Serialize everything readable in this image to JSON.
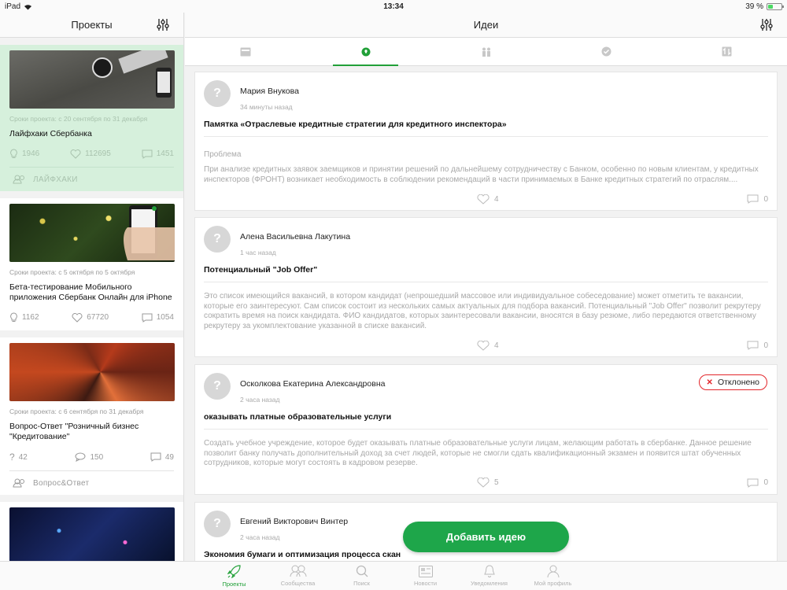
{
  "status": {
    "device": "iPad",
    "time": "13:34",
    "battery": "39 %",
    "battery_level": 0.39
  },
  "left": {
    "title": "Проекты",
    "projects": [
      {
        "dates": "Сроки проекта: с 20 сентября по 31 декабря",
        "title": "Лайфхаки Сбербанка",
        "ideas": "1946",
        "likes": "112695",
        "comments": "1451",
        "tag": "ЛАЙФХАКИ"
      },
      {
        "dates": "Сроки проекта: с 5 октября по 5 октября",
        "title": "Бета-тестирование Мобильного приложения Сбербанк Онлайн для iPhone",
        "ideas": "1162",
        "likes": "67720",
        "comments": "1054"
      },
      {
        "dates": "Сроки проекта: с 6 сентября по 31 декабря",
        "title": "Вопрос-Ответ \"Розничный бизнес \"Кредитование\"",
        "ideas": "42",
        "likes": "150",
        "comments": "49",
        "tag": "Вопрос&Ответ"
      }
    ]
  },
  "main": {
    "title": "Идеи",
    "ideas": [
      {
        "author": "Мария Внукова",
        "time": "34 минуты назад",
        "title": "Памятка «Отраслевые кредитные стратегии для кредитного инспектора»",
        "category": "Проблема",
        "body": "При анализе   кредитных заявок заемщиков и принятии решений по дальнейшему сотрудничеству с   Банком, особенно по новым клиентам, у кредитных инспекторов (ФРОНТ) возникает   необходимость в соблюдении рекомендаций в части принимаемых в Банке кредитных стратегий по отраслям....",
        "likes": "4",
        "comments": "0"
      },
      {
        "author": "Алена Васильевна Лакутина",
        "time": "1 час назад",
        "title": "Потенциальный \"Job Offer\"",
        "body": "Это список имеющийся вакансий, в котором кандидат (непрошедший массовое или индивидуальное собеседование) может отметить те вакансии, которые его заинтересуют. Сам список состоит из нескольких самых актуальных для подбора вакансий. Потенциальный \"Job Offer\" позволит рекрутеру сократить время на поиск кандидата. ФИО кандидатов, которых заинтересовали вакансии, вносятся в  базу резюме, либо передаются ответственному рекрутеру за укомплектование указанной в списке вакансий.",
        "likes": "4",
        "comments": "0"
      },
      {
        "author": "Осколкова Екатерина Александровна",
        "time": "2 часа назад",
        "title": "оказывать платные образовательные услуги",
        "badge": "Отклонено",
        "body": "Создать учебное учреждение, которое будет оказывать платные образовательные услуги лицам, желающим работать в сбербанке. Данное решение позволит банку получать дополнительный доход за счет людей, которые не смогли сдать квалификационный экзамен и появится штат обученных сотрудников, которые могут состоять в кадровом резерве.",
        "likes": "5",
        "comments": "0"
      },
      {
        "author": "Евгений Викторович Винтер",
        "time": "2 часа назад",
        "title": "Экономия бумаги и оптимизация процесса скан"
      }
    ],
    "add_button": "Добавить идею"
  },
  "tabbar": [
    {
      "label": "Проекты",
      "icon": "rocket-icon"
    },
    {
      "label": "Сообщества",
      "icon": "people-icon"
    },
    {
      "label": "Поиск",
      "icon": "search-icon"
    },
    {
      "label": "Новости",
      "icon": "news-icon"
    },
    {
      "label": "Уведомления",
      "icon": "bell-icon"
    },
    {
      "label": "Мой профиль",
      "icon": "profile-icon"
    }
  ],
  "colors": {
    "accent": "#21a038",
    "button": "#1ea64a",
    "rejected": "#e3262b",
    "active_card": "#d6f0dc"
  }
}
